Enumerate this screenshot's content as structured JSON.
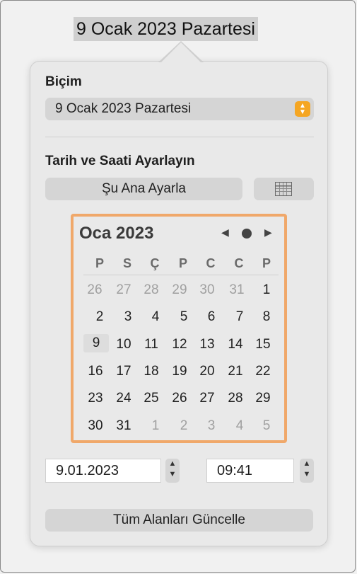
{
  "document": {
    "title": "9 Ocak 2023 Pazartesi"
  },
  "format": {
    "label": "Biçim",
    "selected": "9 Ocak 2023 Pazartesi"
  },
  "datetime": {
    "label": "Tarih ve Saati Ayarlayın",
    "set_now_label": "Şu Ana Ayarla",
    "calendar_icon": "calendar-icon"
  },
  "calendar": {
    "month_label": "Oca 2023",
    "weekdays": [
      "P",
      "S",
      "Ç",
      "P",
      "C",
      "C",
      "P"
    ],
    "weeks": [
      [
        "26",
        "27",
        "28",
        "29",
        "30",
        "31",
        "1"
      ],
      [
        "2",
        "3",
        "4",
        "5",
        "6",
        "7",
        "8"
      ],
      [
        "9",
        "10",
        "11",
        "12",
        "13",
        "14",
        "15"
      ],
      [
        "16",
        "17",
        "18",
        "19",
        "20",
        "21",
        "22"
      ],
      [
        "23",
        "24",
        "25",
        "26",
        "27",
        "28",
        "29"
      ],
      [
        "30",
        "31",
        "1",
        "2",
        "3",
        "4",
        "5"
      ]
    ],
    "highlight_color": "#f0a86a"
  },
  "date_field": {
    "value": "9.01.2023"
  },
  "time_field": {
    "value": "09:41"
  },
  "update_button": {
    "label": "Tüm Alanları Güncelle"
  },
  "colors": {
    "accent": "#f5a623",
    "highlight": "#f0a86a"
  }
}
